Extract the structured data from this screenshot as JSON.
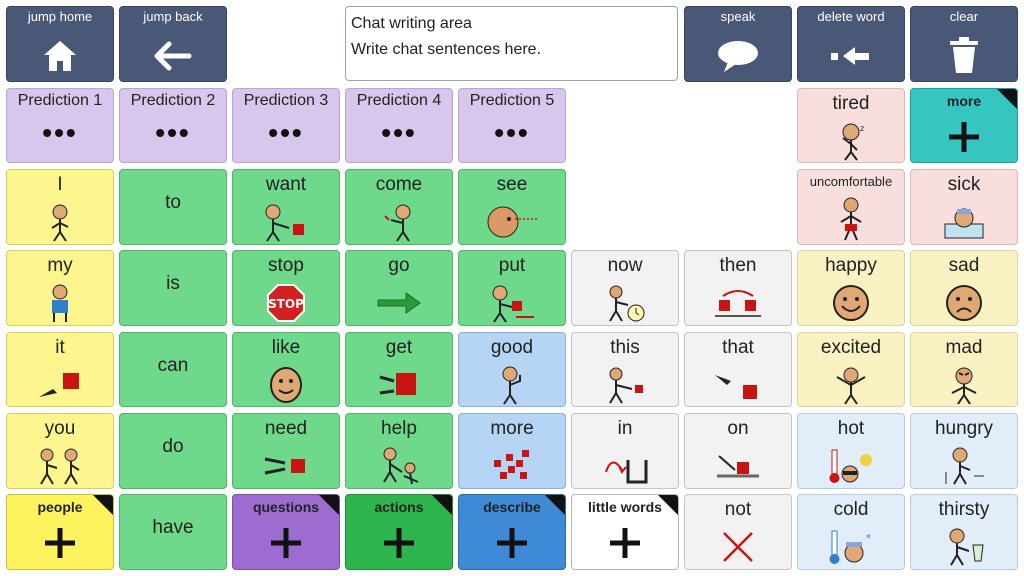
{
  "toolbar": {
    "jump_home": "jump home",
    "jump_back": "jump back",
    "speak": "speak",
    "delete_word": "delete word",
    "clear": "clear"
  },
  "chat": {
    "line1": "Chat writing area",
    "line2": "Write chat sentences here."
  },
  "predictions": {
    "p1": "Prediction 1",
    "p2": "Prediction 2",
    "p3": "Prediction 3",
    "p4": "Prediction 4",
    "p5": "Prediction 5",
    "dots": "•••"
  },
  "words": {
    "I": "I",
    "to": "to",
    "want": "want",
    "come": "come",
    "see": "see",
    "my": "my",
    "is": "is",
    "stop": "stop",
    "go": "go",
    "put": "put",
    "now": "now",
    "then": "then",
    "it": "it",
    "can": "can",
    "like": "like",
    "get": "get",
    "good": "good",
    "this": "this",
    "that": "that",
    "you": "you",
    "do": "do",
    "need": "need",
    "help": "help",
    "more": "more",
    "in": "in",
    "on": "on",
    "have": "have",
    "not": "not",
    "tired": "tired",
    "uncomfortable": "uncomfortable",
    "sick": "sick",
    "happy": "happy",
    "sad": "sad",
    "excited": "excited",
    "mad": "mad",
    "hot": "hot",
    "hungry": "hungry",
    "cold": "cold",
    "thirsty": "thirsty",
    "stop_sign": "STOP"
  },
  "folders": {
    "people": "people",
    "questions": "questions",
    "actions": "actions",
    "describe": "describe",
    "little_words": "little words",
    "more": "more"
  },
  "colors": {
    "toolbar": "#4a5877",
    "prediction": "#d7c7ec",
    "pronoun": "#fdf68e",
    "verb": "#6ed98b",
    "describe": "#b6d4f3",
    "little": "#f2f2f2",
    "feeling": "#f9dede"
  }
}
